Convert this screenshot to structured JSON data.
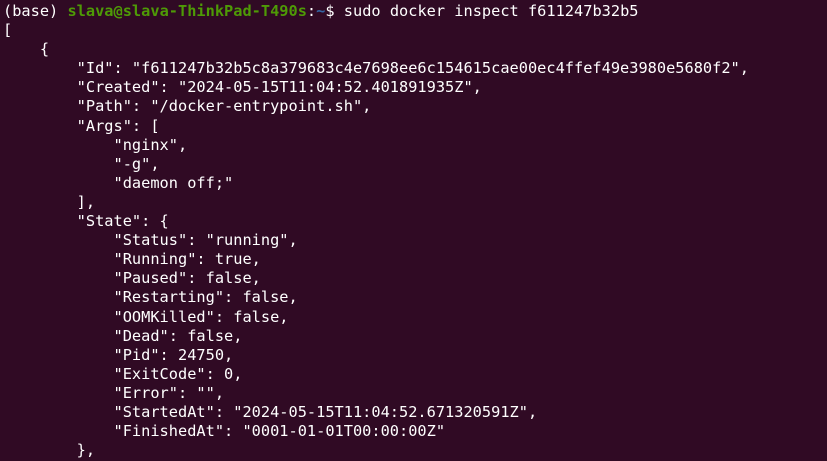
{
  "prompt": {
    "env": "(base) ",
    "user_host": "slava@slava-ThinkPad-T490s",
    "separator": ":",
    "path": "~",
    "symbol": "$ ",
    "command": "sudo docker inspect f611247b32b5"
  },
  "output_lines": [
    "[",
    "    {",
    "        \"Id\": \"f611247b32b5c8a379683c4e7698ee6c154615cae00ec4ffef49e3980e5680f2\",",
    "        \"Created\": \"2024-05-15T11:04:52.401891935Z\",",
    "        \"Path\": \"/docker-entrypoint.sh\",",
    "        \"Args\": [",
    "            \"nginx\",",
    "            \"-g\",",
    "            \"daemon off;\"",
    "        ],",
    "        \"State\": {",
    "            \"Status\": \"running\",",
    "            \"Running\": true,",
    "            \"Paused\": false,",
    "            \"Restarting\": false,",
    "            \"OOMKilled\": false,",
    "            \"Dead\": false,",
    "            \"Pid\": 24750,",
    "            \"ExitCode\": 0,",
    "            \"Error\": \"\",",
    "            \"StartedAt\": \"2024-05-15T11:04:52.671320591Z\",",
    "            \"FinishedAt\": \"0001-01-01T00:00:00Z\"",
    "        },"
  ],
  "colors": {
    "background": "#300a24",
    "text": "#ffffff",
    "prompt_user": "#4e9a06",
    "prompt_path": "#3465a4"
  }
}
